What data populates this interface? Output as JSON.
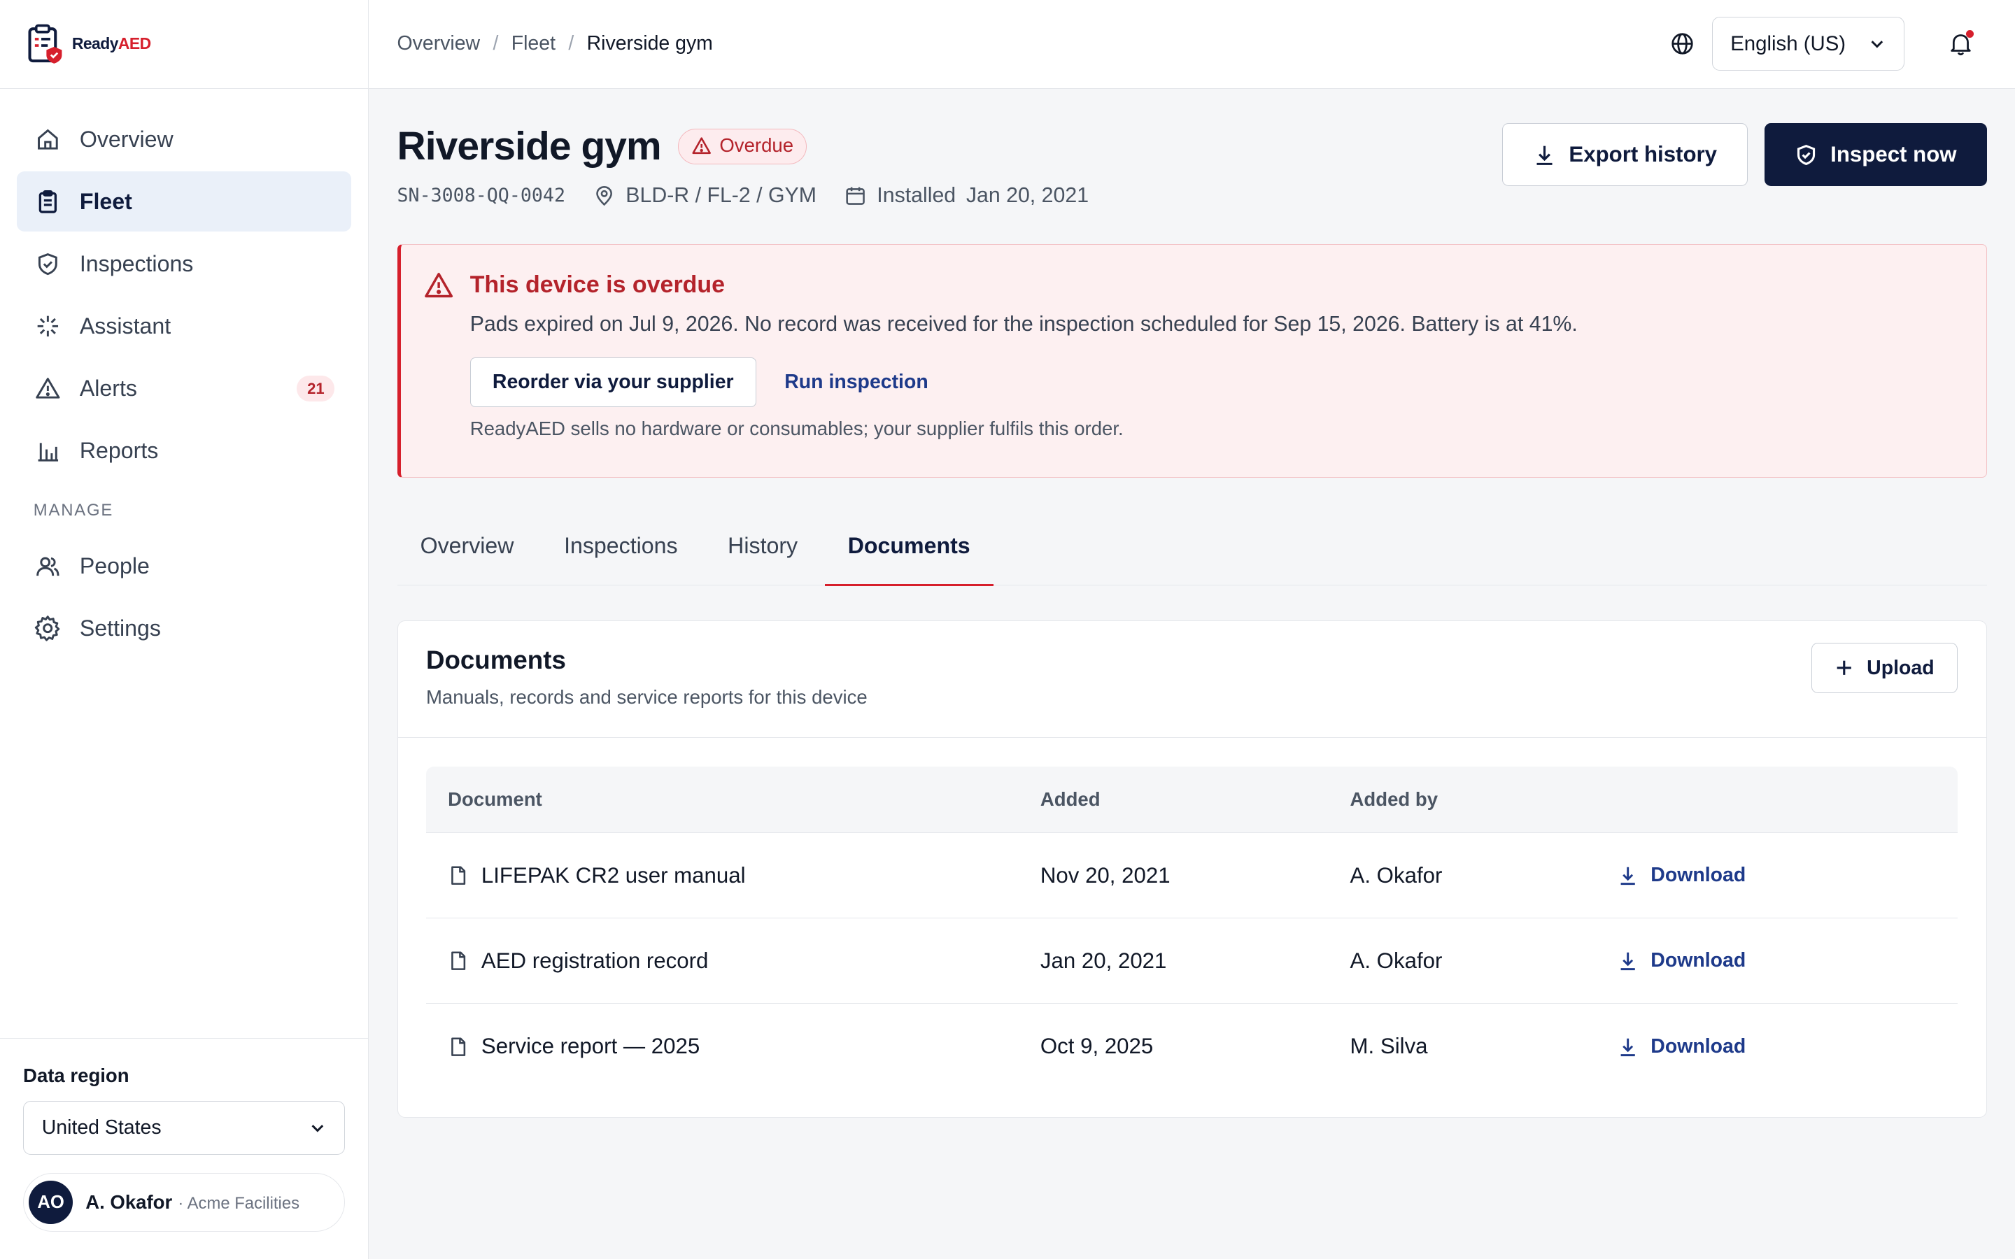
{
  "brand": {
    "name_part1": "Ready",
    "name_part2": "AED"
  },
  "sidebar": {
    "items": [
      {
        "label": "Overview",
        "icon": "home-icon"
      },
      {
        "label": "Fleet",
        "icon": "clipboard-icon",
        "active": true
      },
      {
        "label": "Inspections",
        "icon": "shield-check-icon"
      },
      {
        "label": "Assistant",
        "icon": "sparkle-icon"
      },
      {
        "label": "Alerts",
        "icon": "warning-icon",
        "badge": "21"
      },
      {
        "label": "Reports",
        "icon": "bar-chart-icon"
      }
    ],
    "section_label": "MANAGE",
    "manage_items": [
      {
        "label": "People",
        "icon": "people-icon"
      },
      {
        "label": "Settings",
        "icon": "gear-icon"
      }
    ],
    "data_region_label": "Data region",
    "data_region_value": "United States",
    "user": {
      "initials": "AO",
      "name": "A. Okafor",
      "org": "· Acme Facilities"
    }
  },
  "topbar": {
    "breadcrumbs": [
      "Overview",
      "Fleet",
      "Riverside gym"
    ],
    "breadcrumb_sep": "/",
    "language": "English (US)"
  },
  "device": {
    "title": "Riverside gym",
    "status": "Overdue",
    "serial": "SN-3008-QQ-0042",
    "location": "BLD-R / FL-2 / GYM",
    "installed_label": "Installed",
    "installed_date": "Jan 20, 2021",
    "export_label": "Export history",
    "inspect_label": "Inspect now"
  },
  "alert": {
    "title": "This device is overdue",
    "text": "Pads expired on Jul 9, 2026. No record was received for the inspection scheduled for Sep 15, 2026. Battery is at 41%.",
    "reorder_label": "Reorder via your supplier",
    "run_label": "Run inspection",
    "note": "ReadyAED sells no hardware or consumables; your supplier fulfils this order."
  },
  "tabs": [
    "Overview",
    "Inspections",
    "History",
    "Documents"
  ],
  "active_tab": "Documents",
  "documents": {
    "title": "Documents",
    "subtitle": "Manuals, records and service reports for this device",
    "upload_label": "Upload",
    "columns": [
      "Document",
      "Added",
      "Added by"
    ],
    "rows": [
      {
        "name": "LIFEPAK CR2 user manual",
        "added": "Nov 20, 2021",
        "by": "A. Okafor",
        "action": "Download"
      },
      {
        "name": "AED registration record",
        "added": "Jan 20, 2021",
        "by": "A. Okafor",
        "action": "Download"
      },
      {
        "name": "Service report — 2025",
        "added": "Oct 9, 2025",
        "by": "M. Silva",
        "action": "Download"
      }
    ]
  },
  "colors": {
    "navy": "#0f1b3d",
    "red": "#d61f2c",
    "alert_bg": "#fdf0f1",
    "active_nav_bg": "#eaf0f9"
  }
}
